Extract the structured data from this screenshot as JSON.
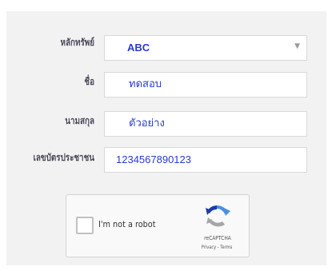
{
  "form": {
    "fields": [
      {
        "label": "หลักทรัพย์",
        "value": "ABC",
        "type": "select"
      },
      {
        "label": "ชื่อ",
        "value": "ทดสอบ",
        "type": "text"
      },
      {
        "label": "นามสกุล",
        "value": "ตัวอย่าง",
        "type": "text"
      },
      {
        "label": "เลขบัตรประชาชน",
        "value": "1234567890123",
        "type": "text"
      }
    ],
    "select_arrow_icon": "chevron-down-icon"
  },
  "captcha": {
    "checkbox_label": "I'm not a robot",
    "brand": "reCAPTCHA",
    "links": "Privacy - Terms",
    "logo_icon": "recaptcha-logo-icon",
    "colors": {
      "logo_blue": "#4a90e2",
      "logo_dark": "#1c3aa9",
      "logo_grey": "#a6a6a6"
    }
  },
  "colors": {
    "panel_bg": "#f2f2f2",
    "value_text": "#2a3bd0",
    "label_text": "#4a4a5a"
  }
}
